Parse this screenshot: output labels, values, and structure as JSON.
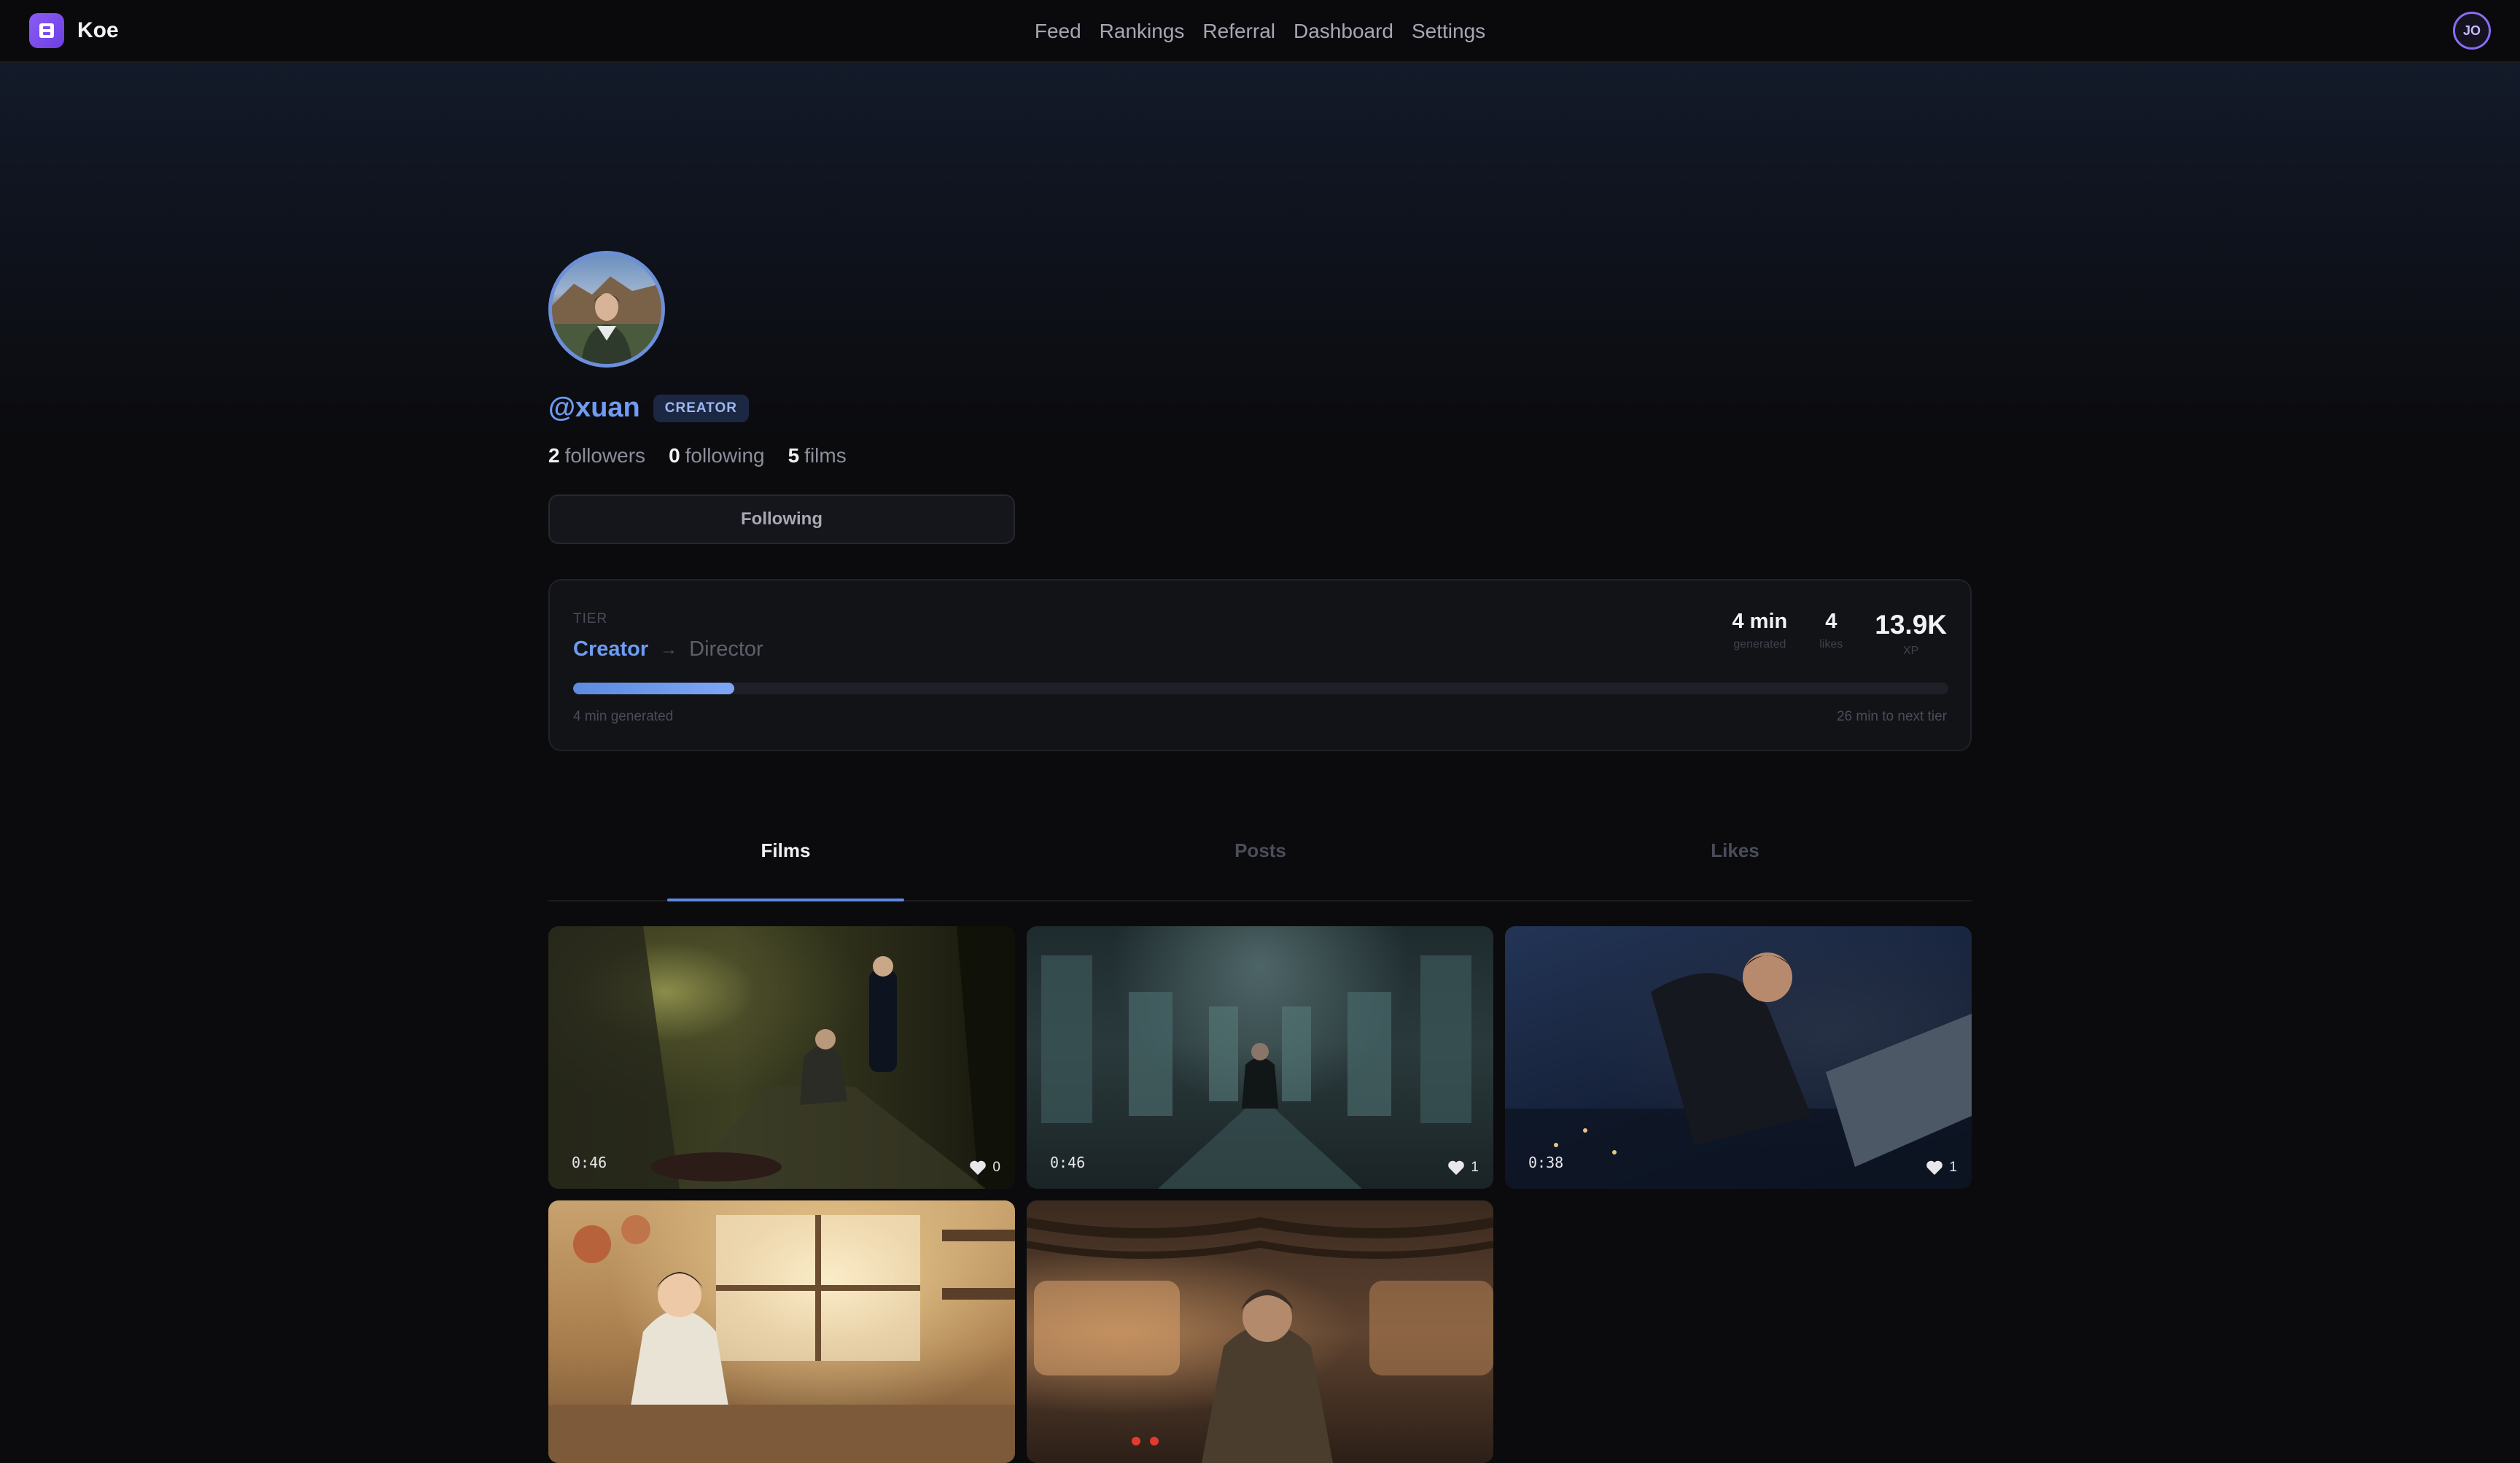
{
  "nav": {
    "brand": "Koe",
    "links": [
      "Feed",
      "Rankings",
      "Referral",
      "Dashboard",
      "Settings"
    ],
    "user_initials": "JO"
  },
  "profile": {
    "username": "@xuan",
    "badge": "CREATOR",
    "stats": {
      "followers_count": "2",
      "followers_label": "followers",
      "following_count": "0",
      "following_label": "following",
      "films_count": "5",
      "films_label": "films"
    },
    "follow_button": "Following"
  },
  "tier": {
    "label": "TIER",
    "current": "Creator",
    "next": "Director",
    "progress_fraction": 0.117,
    "metrics": [
      {
        "value": "4 min",
        "label": "generated"
      },
      {
        "value": "4",
        "label": "likes"
      },
      {
        "value": "13.9K",
        "label": "XP"
      }
    ],
    "foot_left": "4 min generated",
    "foot_right": "26 min to next tier"
  },
  "tabs": [
    "Films",
    "Posts",
    "Likes"
  ],
  "films": [
    {
      "duration": "0:46",
      "likes": "0"
    },
    {
      "duration": "0:46",
      "likes": "1"
    },
    {
      "duration": "0:38",
      "likes": "1"
    },
    {
      "duration": "",
      "likes": ""
    },
    {
      "duration": "",
      "likes": ""
    }
  ],
  "colors": {
    "accent": "#6f9cf2",
    "brand": "#8b5cf6",
    "background": "#0b0b0e"
  }
}
